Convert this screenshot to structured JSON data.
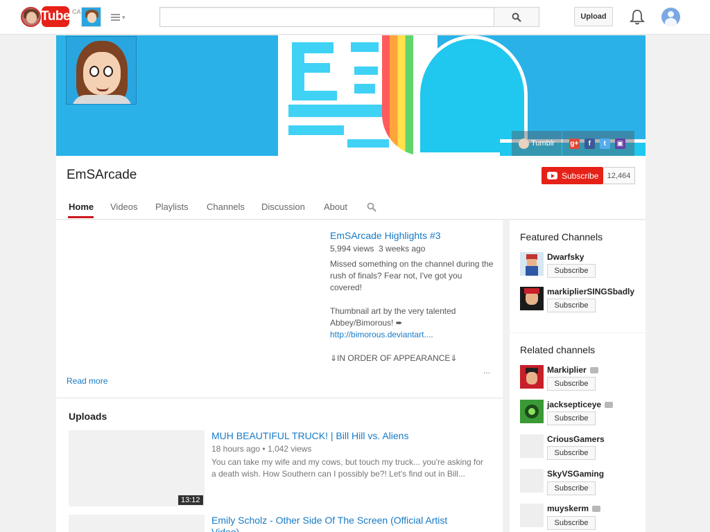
{
  "masthead": {
    "logo_text": "Tube",
    "country_code": "CA",
    "search_placeholder": "",
    "upload_label": "Upload"
  },
  "banner": {
    "links": [
      {
        "label": "Tumblr",
        "icon": "tumblr-avatar-icon"
      }
    ],
    "social_icons": [
      "google-plus-icon",
      "facebook-icon",
      "twitter-icon",
      "twitch-icon"
    ]
  },
  "channel": {
    "title": "EmSArcade",
    "subscribe_label": "Subscribe",
    "subscriber_count": "12,464"
  },
  "tabs": [
    {
      "label": "Home",
      "active": true
    },
    {
      "label": "Videos"
    },
    {
      "label": "Playlists"
    },
    {
      "label": "Channels"
    },
    {
      "label": "Discussion"
    },
    {
      "label": "About"
    }
  ],
  "featured_video": {
    "title": "EmSArcade Highlights #3",
    "views": "5,994 views",
    "age": "3 weeks ago",
    "description_1": "Missed something on the channel during the rush of finals? Fear not, I've got you covered!",
    "description_2": "Thumbnail art by the very talented Abbey/Bimorous! ➨",
    "link": "http://bimorous.deviantart....",
    "description_3": "⇓IN ORDER OF APPEARANCE⇓",
    "more": "...",
    "read_more": "Read more"
  },
  "uploads": {
    "heading": "Uploads",
    "items": [
      {
        "title": "MUH BEAUTIFUL TRUCK! | Bill Hill vs. Aliens",
        "age": "18 hours ago",
        "views": "1,042 views",
        "description": "You can take my wife and my cows, but touch my truck... you're asking for a death wish. How Southern can I possibly be?! Let's find out in Bill...",
        "duration": "13:12"
      },
      {
        "title": "Emily Scholz - Other Side Of The Screen (Official Artist Video)"
      }
    ]
  },
  "featured_channels": {
    "heading": "Featured Channels",
    "items": [
      {
        "name": "Dwarfsky",
        "button": "Subscribe"
      },
      {
        "name": "markiplierSINGSbadly",
        "button": "Subscribe"
      }
    ]
  },
  "related_channels": {
    "heading": "Related channels",
    "items": [
      {
        "name": "Markiplier",
        "verified": true,
        "button": "Subscribe"
      },
      {
        "name": "jacksepticeye",
        "verified": true,
        "button": "Subscribe"
      },
      {
        "name": "CriousGamers",
        "verified": false,
        "button": "Subscribe"
      },
      {
        "name": "SkyVSGaming",
        "verified": false,
        "button": "Subscribe"
      },
      {
        "name": "muyskerm",
        "verified": true,
        "button": "Subscribe"
      }
    ]
  },
  "colors": {
    "brand_red": "#e62117",
    "link_blue": "#167ac6",
    "banner_blue": "#2ab1e8"
  }
}
